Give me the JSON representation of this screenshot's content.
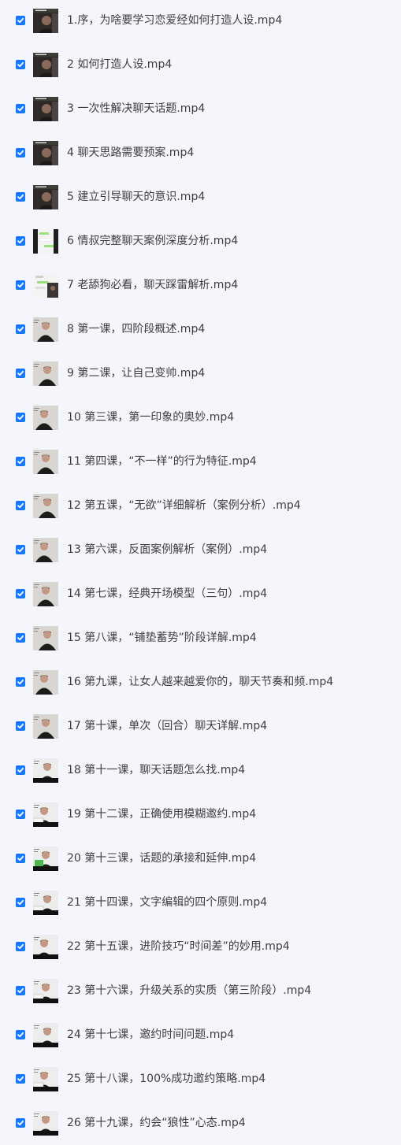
{
  "files": [
    {
      "name": "1.序，为啥要学习恋爱经如何打造人设.mp4",
      "checked": true,
      "thumb": "dark-portrait-thumbnail"
    },
    {
      "name": "2 如何打造人设.mp4",
      "checked": true,
      "thumb": "dark-portrait-thumbnail"
    },
    {
      "name": "3 一次性解决聊天话题.mp4",
      "checked": true,
      "thumb": "dark-portrait-thumbnail"
    },
    {
      "name": "4 聊天思路需要预案.mp4",
      "checked": true,
      "thumb": "dark-portrait-thumbnail"
    },
    {
      "name": "5 建立引导聊天的意识.mp4",
      "checked": true,
      "thumb": "dark-portrait-thumbnail"
    },
    {
      "name": "6 情叔完整聊天案例深度分析.mp4",
      "checked": true,
      "thumb": "chat-screenshot-thumbnail"
    },
    {
      "name": "7 老舔狗必看，聊天踩雷解析.mp4",
      "checked": true,
      "thumb": "chat-screenshot-thumbnail"
    },
    {
      "name": "8 第一课，四阶段概述.mp4",
      "checked": true,
      "thumb": "lecture-thumbnail"
    },
    {
      "name": "9 第二课，让自己变帅.mp4",
      "checked": true,
      "thumb": "lecture-thumbnail"
    },
    {
      "name": "10 第三课，第一印象的奥妙.mp4",
      "checked": true,
      "thumb": "lecture-thumbnail"
    },
    {
      "name": "11 第四课，“不一样”的行为特征.mp4",
      "checked": true,
      "thumb": "lecture-thumbnail"
    },
    {
      "name": "12 第五课，“无欲”详细解析（案例分析）.mp4",
      "checked": true,
      "thumb": "lecture-thumbnail"
    },
    {
      "name": "13 第六课，反面案例解析（案例）.mp4",
      "checked": true,
      "thumb": "lecture-thumbnail"
    },
    {
      "name": "14 第七课，经典开场模型（三句）.mp4",
      "checked": true,
      "thumb": "lecture-thumbnail"
    },
    {
      "name": "15 第八课，“铺垫蓄势”阶段详解.mp4",
      "checked": true,
      "thumb": "lecture-thumbnail"
    },
    {
      "name": "16 第九课，让女人越来越爱你的，聊天节奏和频.mp4",
      "checked": true,
      "thumb": "lecture-thumbnail"
    },
    {
      "name": "17 第十课，单次（回合）聊天详解.mp4",
      "checked": true,
      "thumb": "lecture-thumbnail"
    },
    {
      "name": "18 第十一课，聊天话题怎么找.mp4",
      "checked": true,
      "thumb": "lecture-thumbnail"
    },
    {
      "name": "19 第十二课，正确使用模糊邀约.mp4",
      "checked": true,
      "thumb": "lecture-thumbnail"
    },
    {
      "name": "20 第十三课，话题的承接和延伸.mp4",
      "checked": true,
      "thumb": "lecture-thumbnail"
    },
    {
      "name": "21 第十四课，文字编辑的四个原则.mp4",
      "checked": true,
      "thumb": "lecture-thumbnail"
    },
    {
      "name": "22 第十五课，进阶技巧“时间差”的妙用.mp4",
      "checked": true,
      "thumb": "lecture-thumbnail"
    },
    {
      "name": "23 第十六课，升级关系的实质（第三阶段）.mp4",
      "checked": true,
      "thumb": "lecture-thumbnail"
    },
    {
      "name": "24 第十七课，邀约时间问题.mp4",
      "checked": true,
      "thumb": "lecture-thumbnail"
    },
    {
      "name": "25 第十八课，100%成功邀约策略.mp4",
      "checked": true,
      "thumb": "lecture-thumbnail"
    },
    {
      "name": "26 第十九课，约会“狼性”心态.mp4",
      "checked": true,
      "thumb": "lecture-thumbnail"
    }
  ],
  "colors": {
    "background": "#f5f6fb",
    "checkbox": "#1677ff",
    "text": "#3e3e3e"
  }
}
